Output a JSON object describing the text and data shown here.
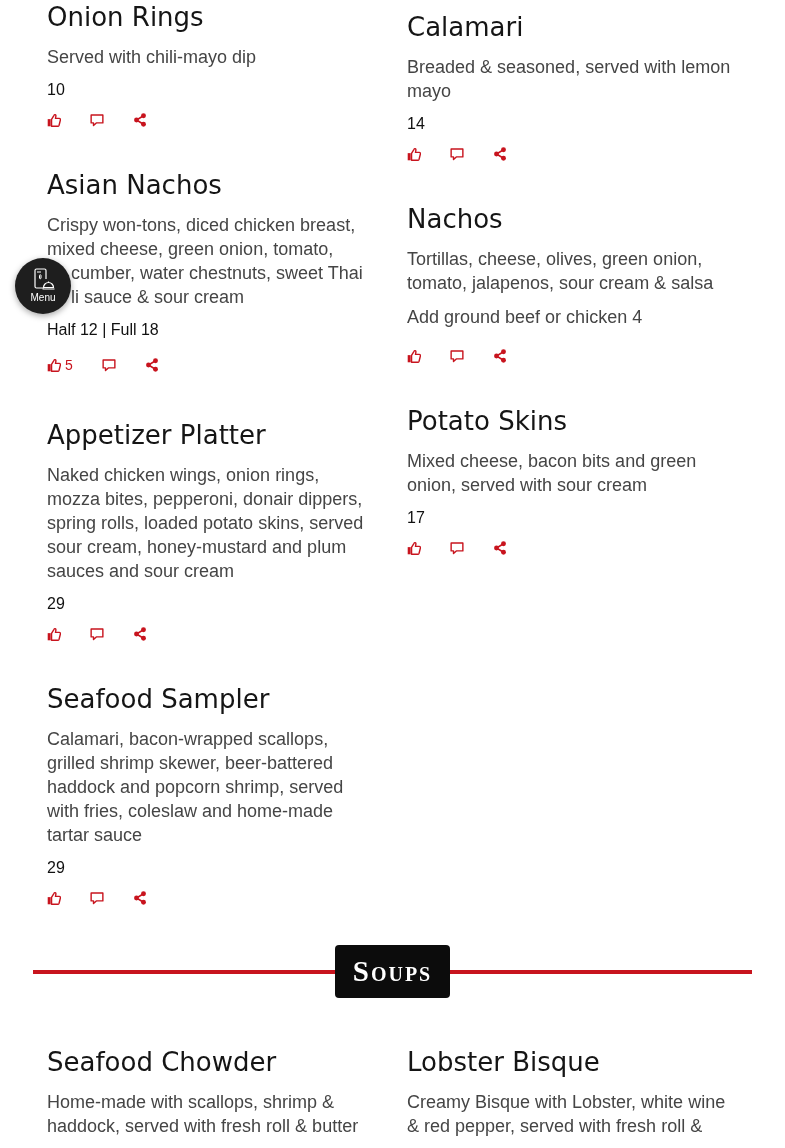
{
  "sections": [
    {
      "columns": [
        [
          {
            "name": "Onion Rings",
            "description": "Served with chili-mayo dip",
            "price": "10"
          },
          {
            "name": "Asian Nachos",
            "description": "Crispy won-tons, diced chicken breast, mixed cheese, green onion, tomato,",
            "description_continued": "cumber, water chestnuts, sweet Thai li sauce & sour cream",
            "price": "Half 12 | Full 18",
            "likes": "5"
          },
          {
            "name": "Appetizer Platter",
            "description": "Naked chicken wings, onion rings, mozza bites, pepperoni, donair dippers, spring rolls, loaded potato skins, served sour cream, honey-mustard and plum sauces and sour cream",
            "price": "29"
          },
          {
            "name": "Seafood Sampler",
            "description": "Calamari, bacon-wrapped scallops, grilled shrimp skewer, beer-battered haddock and popcorn shrimp, served with fries, coleslaw and home-made tartar sauce",
            "price": "29"
          }
        ],
        [
          {
            "name": "Calamari",
            "description": "Breaded & seasoned, served with lemon mayo",
            "price": "14"
          },
          {
            "name": "Nachos",
            "description": "Tortillas, cheese, olives, green onion, tomato, jalapenos, sour cream & salsa",
            "note": "Add ground beef or chicken 4"
          },
          {
            "name": "Potato Skins",
            "description": "Mixed cheese, bacon bits and green onion, served with sour cream",
            "price": "17"
          }
        ]
      ]
    },
    {
      "heading": "Soups",
      "columns": [
        [
          {
            "name": "Seafood Chowder",
            "description": "Home-made with scallops, shrimp & haddock, served with fresh roll & butter"
          }
        ],
        [
          {
            "name": "Lobster Bisque",
            "description": "Creamy Bisque with Lobster, white wine & red pepper, served with fresh roll &"
          }
        ]
      ]
    }
  ],
  "floating_button": {
    "label": "Menu"
  }
}
